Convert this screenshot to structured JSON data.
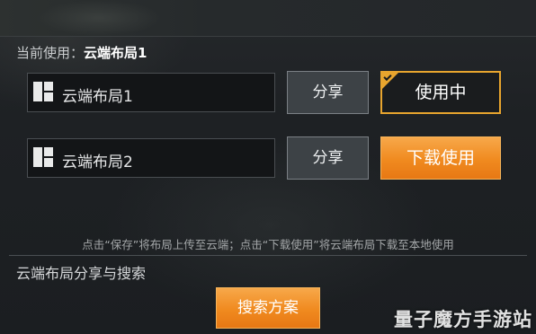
{
  "current_layout": {
    "label": "当前使用：",
    "value": "云端布局1"
  },
  "layouts": [
    {
      "name": "云端布局1",
      "share_label": "分享",
      "action_label": "使用中",
      "icon": "layout-grid-icon"
    },
    {
      "name": "云端布局2",
      "share_label": "分享",
      "action_label": "下载使用",
      "icon": "layout-grid-icon"
    }
  ],
  "hint_text": "点击“保存”将布局上传至云端；点击“下载使用”将云端布局下载至本地使用",
  "section": {
    "title": "云端布局分享与搜索",
    "search_button": "搜索方案"
  },
  "watermark": "量子魔方手游站",
  "colors": {
    "accent_orange": "#f08a1f",
    "in_use_border": "#e8a52e",
    "background": "#1c1f22"
  }
}
